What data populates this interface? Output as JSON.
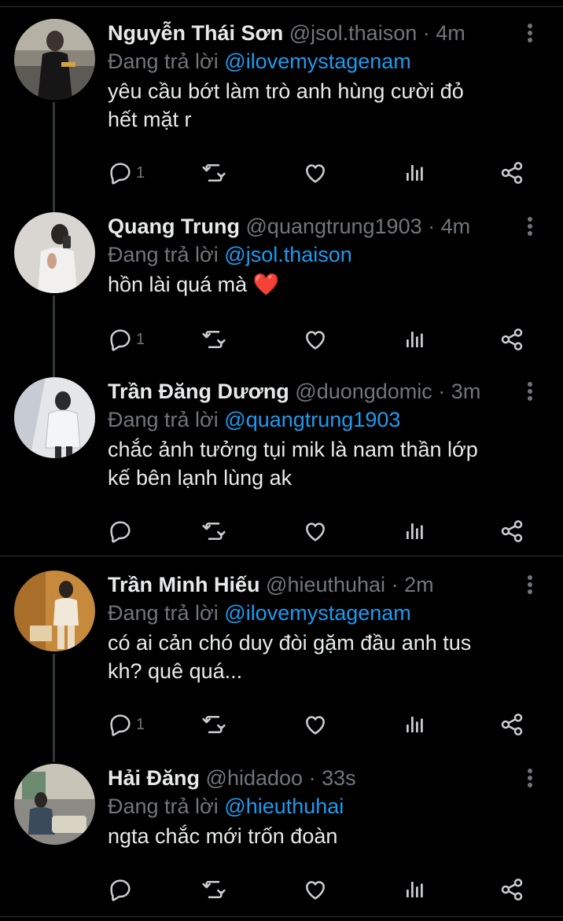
{
  "tweets": [
    {
      "name": "Nguyễn Thái Sơn",
      "handle": "@jsol.thaison",
      "time": "4m",
      "reply_label": "Đang trả lời",
      "reply_to": "@ilovemystagenam",
      "line1": "yêu cầu bớt làm trò anh hùng cười đỏ",
      "line2": "hết mặt r",
      "reply_count": "1"
    },
    {
      "name": "Quang Trung",
      "handle": "@quangtrung1903",
      "time": "4m",
      "reply_label": "Đang trả lời",
      "reply_to": "@jsol.thaison",
      "line1": "hồn lài quá mà ❤️",
      "line2": "",
      "reply_count": "1"
    },
    {
      "name": "Trần Đăng Dương",
      "handle": "@duongdomic",
      "time": "3m",
      "reply_label": "Đang trả lời",
      "reply_to": "@quangtrung1903",
      "line1": "chắc ảnh tưởng tụi mik là nam thần lớp",
      "line2": "kế bên lạnh lùng ak",
      "reply_count": ""
    },
    {
      "name": "Trần Minh Hiếu",
      "handle": "@hieuthuhai",
      "time": "2m",
      "reply_label": "Đang trả lời",
      "reply_to": "@ilovemystagenam",
      "line1": "có ai cản chó duy đòi gặm đầu anh tus",
      "line2": "kh? quê quá...",
      "reply_count": "1"
    },
    {
      "name": "Hải Đăng",
      "handle": "@hidadoo",
      "time": "33s",
      "reply_label": "Đang trả lời",
      "reply_to": "@hieuthuhai",
      "line1": "ngta chắc mới trốn đoàn",
      "line2": "",
      "reply_count": ""
    }
  ],
  "icons": {
    "reply": "reply-icon",
    "retweet": "retweet-icon",
    "like": "heart-icon",
    "views": "views-icon",
    "share": "share-icon",
    "menu": "more-options-icon"
  },
  "colors": {
    "background": "#000000",
    "text": "#e7e9ea",
    "muted": "#71767b",
    "accent": "#1d9bf0",
    "divider": "#2f3336"
  }
}
